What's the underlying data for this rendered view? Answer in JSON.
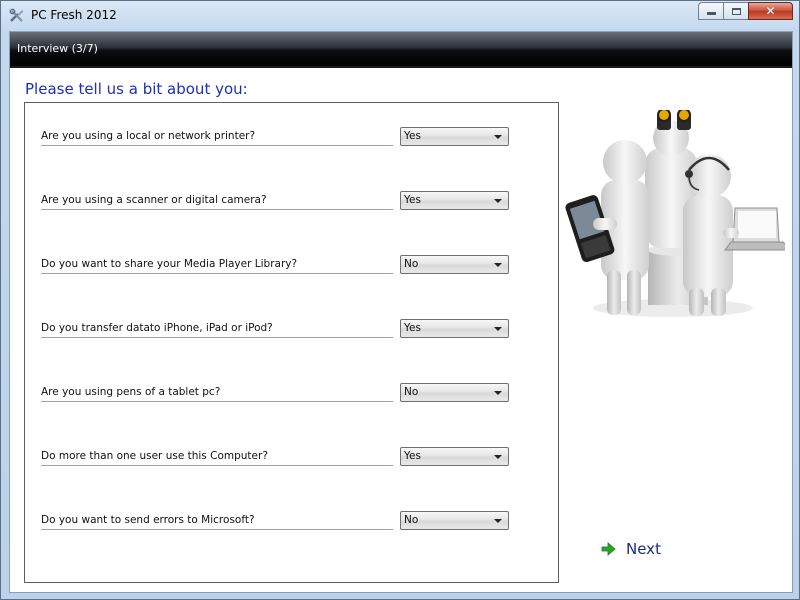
{
  "window": {
    "title": "PC Fresh 2012"
  },
  "header": {
    "step_label": "Interview (3/7)"
  },
  "heading": "Please tell us a bit about you:",
  "questions": [
    {
      "label": "Are you using a local or network printer?",
      "value": "Yes"
    },
    {
      "label": "Are you using a scanner or digital camera?",
      "value": "Yes"
    },
    {
      "label": "Do you want to share your Media Player Library?",
      "value": "No"
    },
    {
      "label": "Do you transfer datato iPhone, iPad or iPod?",
      "value": "Yes"
    },
    {
      "label": "Are you using pens of a tablet pc?",
      "value": "No"
    },
    {
      "label": "Do more than one user use this Computer?",
      "value": "Yes"
    },
    {
      "label": "Do you want to send errors to Microsoft?",
      "value": "No"
    }
  ],
  "next_button": {
    "label": "Next",
    "icon": "arrow-right-icon"
  },
  "colors": {
    "heading": "#1d2fb8",
    "next_arrow": "#2aa52a"
  }
}
